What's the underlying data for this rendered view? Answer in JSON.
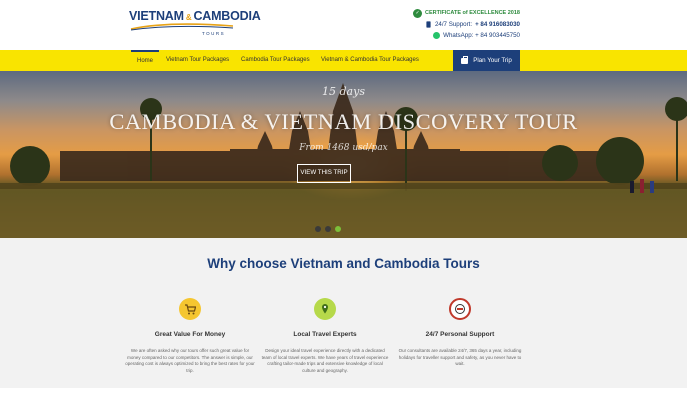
{
  "brand": {
    "logo_vietnam": "VIETNAM",
    "logo_amp": "&",
    "logo_cambodia": "CAMBODIA",
    "logo_tours": "TOURS",
    "primary_color": "#1d3f7a",
    "accent_color": "#f9e400"
  },
  "contact": {
    "certificate": "CERTIFICATE of EXCELLENCE 2018",
    "support_label": "24/7 Support: ",
    "support_number": "+ 84 916083030",
    "whatsapp": "WhatsApp: + 84 903445750"
  },
  "nav": {
    "items": [
      {
        "label": "Home",
        "active": true
      },
      {
        "label": "Vietnam Tour Packages",
        "active": false
      },
      {
        "label": "Cambodia Tour Packages",
        "active": false
      },
      {
        "label": "Vietnam & Cambodia Tour Packages",
        "active": false
      }
    ],
    "plan_button": "Plan Your Trip"
  },
  "hero": {
    "days": "15 days",
    "title": "CAMBODIA & VIETNAM DISCOVERY TOUR",
    "price": "From 1468 usd/pax",
    "button": "VIEW THIS TRIP",
    "slides": 3,
    "active_slide": 3
  },
  "why": {
    "title": "Why choose Vietnam and Cambodia Tours",
    "features": [
      {
        "icon": "cart-icon",
        "title": "Great Value For Money",
        "desc": "We are often asked why our tours offer such great value for money compared to our competitors. The answer is simple, our operating cost is always optimized to bring the best rates for your trip."
      },
      {
        "icon": "map-pin-icon",
        "title": "Local Travel Experts",
        "desc": "Design your ideal travel experience directly with a dedicated team of local travel experts. We have years of travel experience crafting tailor-made trips and extensive knowledge of local culture and geography."
      },
      {
        "icon": "support-24-7-icon",
        "title": "24/7 Personal Support",
        "desc": "Our consultants are available 24/7, 365 days a year, including holidays for traveller support and safety, as you never have to wait."
      }
    ]
  }
}
